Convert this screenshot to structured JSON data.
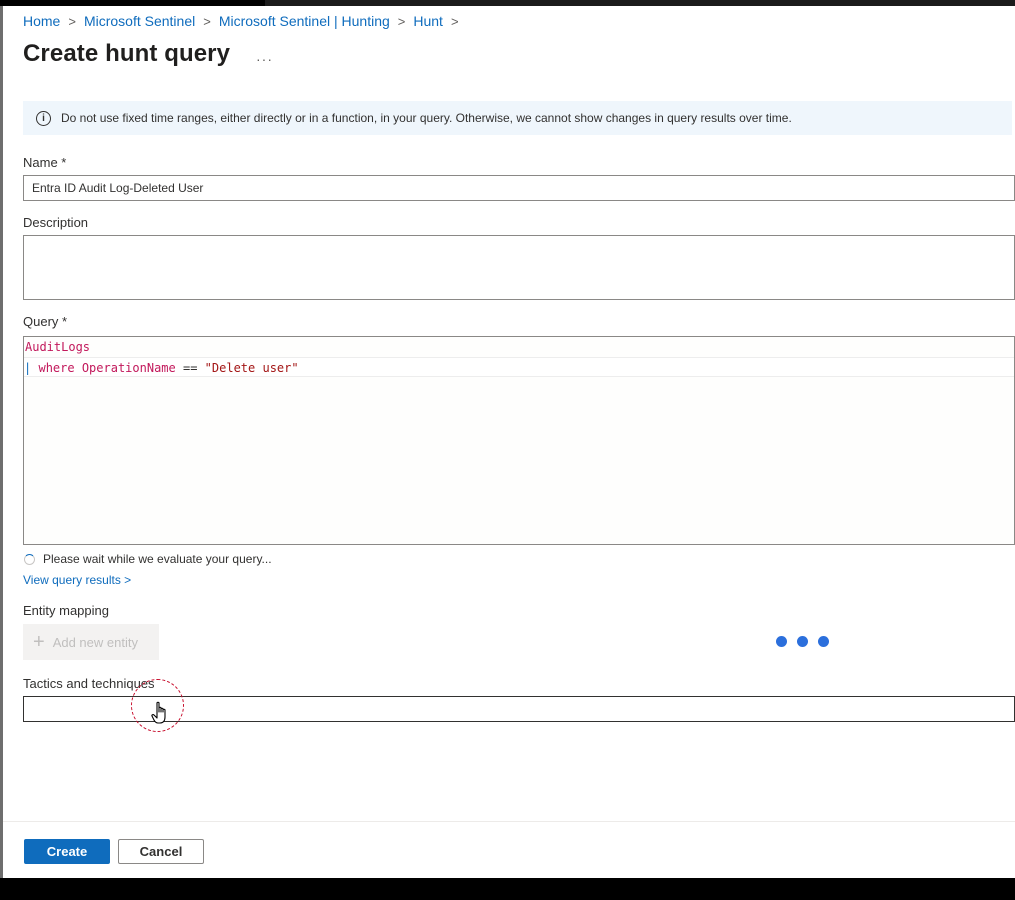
{
  "breadcrumb": {
    "items": [
      "Home",
      "Microsoft Sentinel",
      "Microsoft Sentinel | Hunting",
      "Hunt"
    ],
    "separator": ">"
  },
  "page": {
    "title": "Create hunt query",
    "more_label": "···"
  },
  "info_banner": {
    "icon": "info-icon",
    "text": "Do not use fixed time ranges, either directly or in a function, in your query. Otherwise, we cannot show changes in query results over time."
  },
  "form": {
    "name_label": "Name *",
    "name_value": "Entra ID Audit Log-Deleted User",
    "description_label": "Description",
    "description_value": "",
    "query_label": "Query *",
    "query_lines": {
      "line1": "AuditLogs",
      "line2_pipe": "|",
      "line2_keyword": "where",
      "line2_field": "OperationName",
      "line2_operator": "==",
      "line2_string": "\"Delete user\""
    },
    "evaluating_text": "Please wait while we evaluate your query...",
    "view_results_link": "View query results >",
    "entity_mapping_label": "Entity mapping",
    "add_entity_label": "Add new entity",
    "tactics_label": "Tactics and techniques",
    "tactics_value": ""
  },
  "footer": {
    "create_label": "Create",
    "cancel_label": "Cancel"
  },
  "colors": {
    "accent": "#0f6cbd",
    "info_background": "#eff6fc",
    "loading_dots": "#2b6fdc",
    "click_indicator": "#c8102e"
  }
}
